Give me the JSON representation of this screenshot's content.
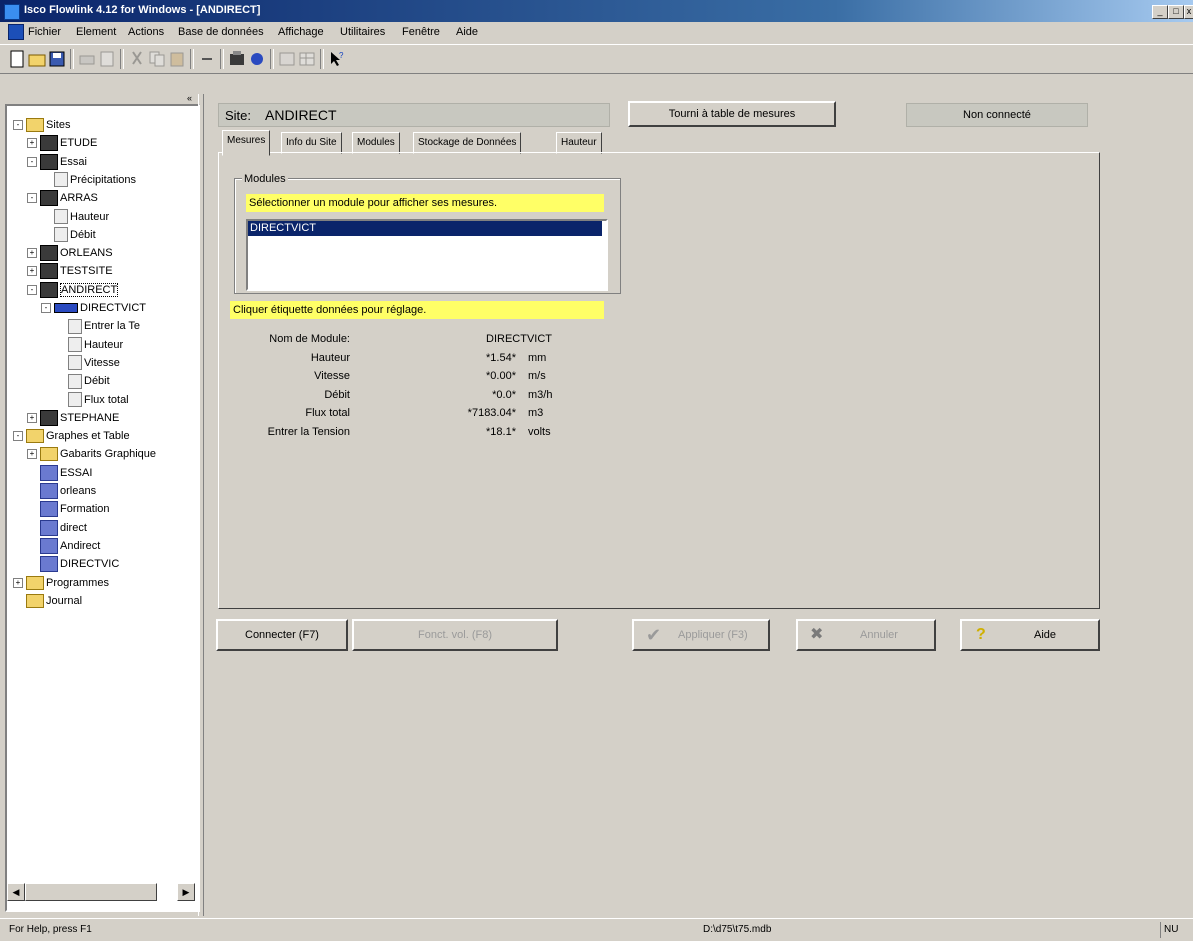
{
  "window": {
    "title": "Isco Flowlink 4.12 for Windows - [ANDIRECT]",
    "controls": [
      "_",
      "□",
      "x"
    ]
  },
  "menu": [
    "Fichier",
    "Element",
    "Actions",
    "Base de données",
    "Affichage",
    "Utilitaires",
    "Fenêtre",
    "Aide"
  ],
  "tree": {
    "nodes": [
      {
        "label": "Sites",
        "icon": "folder",
        "exp": "-"
      },
      {
        "label": "ETUDE",
        "icon": "site",
        "exp": "+"
      },
      {
        "label": "Essai",
        "icon": "site",
        "exp": "-"
      },
      {
        "label": "Précipitations",
        "icon": "doc",
        "exp": ""
      },
      {
        "label": "ARRAS",
        "icon": "site",
        "exp": "-"
      },
      {
        "label": "Hauteur",
        "icon": "doc",
        "exp": ""
      },
      {
        "label": "Débit",
        "icon": "doc",
        "exp": ""
      },
      {
        "label": "ORLEANS",
        "icon": "site",
        "exp": "+"
      },
      {
        "label": "TESTSITE",
        "icon": "site",
        "exp": "+"
      },
      {
        "label": "ANDIRECT",
        "icon": "site",
        "exp": "-"
      },
      {
        "label": "DIRECTVICT",
        "icon": "module",
        "exp": "-"
      },
      {
        "label": "Entrer la Te",
        "icon": "doc",
        "exp": ""
      },
      {
        "label": "Hauteur",
        "icon": "doc",
        "exp": ""
      },
      {
        "label": "Vitesse",
        "icon": "doc",
        "exp": ""
      },
      {
        "label": "Débit",
        "icon": "doc",
        "exp": ""
      },
      {
        "label": "Flux total",
        "icon": "doc",
        "exp": ""
      },
      {
        "label": "STEPHANE",
        "icon": "site",
        "exp": "+"
      },
      {
        "label": "Graphes et Table",
        "icon": "folder",
        "exp": "-"
      },
      {
        "label": "Gabarits Graphique",
        "icon": "folder",
        "exp": "+"
      },
      {
        "label": "ESSAI",
        "icon": "graph",
        "exp": ""
      },
      {
        "label": "orleans",
        "icon": "graph",
        "exp": ""
      },
      {
        "label": "Formation",
        "icon": "graph",
        "exp": ""
      },
      {
        "label": "direct",
        "icon": "graph",
        "exp": ""
      },
      {
        "label": "Andirect",
        "icon": "graph",
        "exp": ""
      },
      {
        "label": "DIRECTVIC",
        "icon": "graph",
        "exp": ""
      },
      {
        "label": "Programmes",
        "icon": "folder",
        "exp": "+"
      },
      {
        "label": "Journal",
        "icon": "folder",
        "exp": ""
      }
    ]
  },
  "header": {
    "site_label": "Site:",
    "site_name": "ANDIRECT",
    "table_button": "Tourni à table de mesures",
    "connection_status": "Non connecté"
  },
  "tabs": [
    "Mesures",
    "Info du Site",
    "Modules",
    "Stockage de Données",
    "Hauteur"
  ],
  "modules_group": {
    "title": "Modules",
    "hint": "Sélectionner un module pour afficher ses mesures.",
    "items": [
      "DIRECTVICT"
    ]
  },
  "data_hint": "Cliquer étiquette données pour réglage.",
  "readings": [
    {
      "label": "Nom de Module:",
      "value": "DIRECTVICT",
      "unit": ""
    },
    {
      "label": "Hauteur",
      "value": "*1.54*",
      "unit": "mm"
    },
    {
      "label": "Vitesse",
      "value": "*0.00*",
      "unit": "m/s"
    },
    {
      "label": "Débit",
      "value": "*0.0*",
      "unit": "m3/h"
    },
    {
      "label": "Flux total",
      "value": "*7183.04*",
      "unit": "m3"
    },
    {
      "label": "Entrer la Tension",
      "value": "*18.1*",
      "unit": "volts"
    }
  ],
  "buttons": {
    "connect": "Connecter (F7)",
    "mid": "Fonct. vol. (F8)",
    "apply": "Appliquer (F3)",
    "cancel": "Annuler",
    "help": "Aide"
  },
  "statusbar": {
    "help": "For Help, press F1",
    "db": "D:\\d75\\t75.mdb",
    "mode": "NU"
  }
}
